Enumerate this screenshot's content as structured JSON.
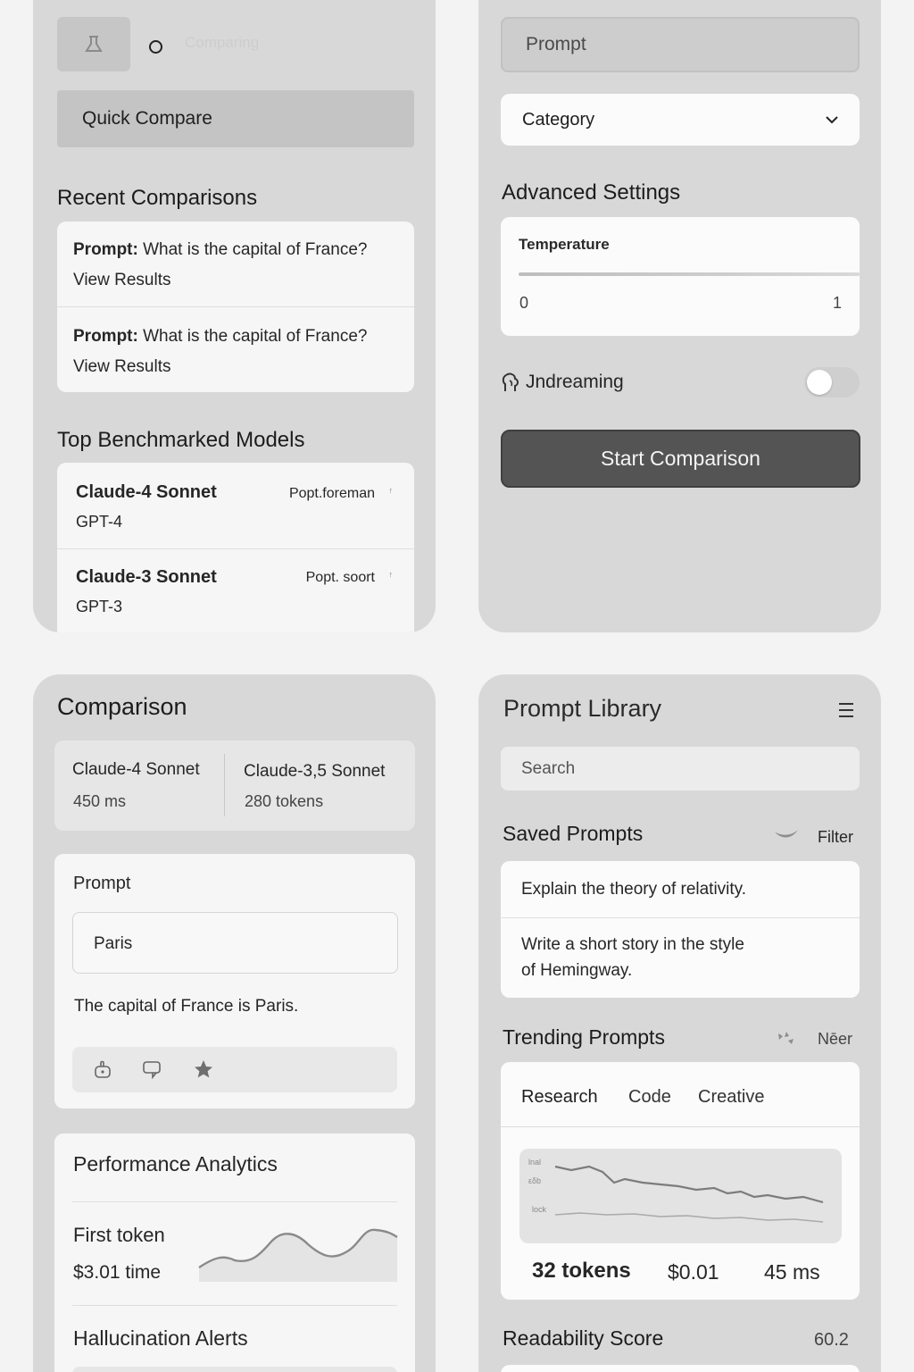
{
  "quick_panel": {
    "faded_header": "Comparing",
    "quick_compare_label": "Quick Compare",
    "recent_title": "Recent Comparisons",
    "recent": [
      {
        "prompt_label": "Prompt:",
        "prompt_text": "What is the capital of France?",
        "link": "View Results"
      },
      {
        "prompt_label": "Prompt:",
        "prompt_text": "What is the capital of France?",
        "link": "View Results"
      }
    ],
    "top_title": "Top Benchmarked Models",
    "top_models": [
      {
        "name": "Claude-4 Sonnet",
        "sub": "GPT-4",
        "meta": "Popt.foreman"
      },
      {
        "name": "Claude-3 Sonnet",
        "sub": "GPT-3",
        "meta": "Popt. soort"
      }
    ]
  },
  "form_panel": {
    "prompt_placeholder": "Prompt",
    "category_label": "Category",
    "advanced_title": "Advanced Settings",
    "temperature_label": "Temperature",
    "slider_min": "0",
    "slider_max": "1",
    "toggle_label": "Jndreaming",
    "toggle_on": false,
    "start_label": "Start Comparison"
  },
  "comparison_panel": {
    "title": "Comparison",
    "model_a": {
      "name": "Claude-4 Sonnet",
      "stat": "450 ms"
    },
    "model_b": {
      "name": "Claude-3,5 Sonnet",
      "stat": "280 tokens"
    },
    "prompt_title": "Prompt",
    "answer_short": "Paris",
    "answer_long": "The capital of France is Paris.",
    "analytics_title": "Performance Analytics",
    "first_token_label": "First token",
    "first_token_value": "$3.01 time",
    "hallucination_title": "Hallucination Alerts"
  },
  "library_panel": {
    "title": "Prompt Library",
    "search_placeholder": "Search",
    "saved_title": "Saved Prompts",
    "filter_label": "Filter",
    "saved": [
      "Explain the theory of relativity.",
      "Write a short story in the style of Hemingway."
    ],
    "saved_line2": "of Hemingway.",
    "saved_line1": "Write a short story in the style",
    "trending_title": "Trending Prompts",
    "trending_action": "Nēer",
    "tabs": [
      "Research",
      "Code",
      "Creative"
    ],
    "chart_axis": [
      "lnal",
      "εδb",
      "lock"
    ],
    "stats": {
      "tokens": "32 tokens",
      "cost": "$0.01",
      "latency": "45 ms"
    },
    "readability_label": "Readability Score",
    "readability_value": "60.2"
  },
  "colors": {
    "panel": "#d8d8d8",
    "card": "#f6f6f6",
    "button_dark": "#545454",
    "page": "#f3f3f3"
  }
}
